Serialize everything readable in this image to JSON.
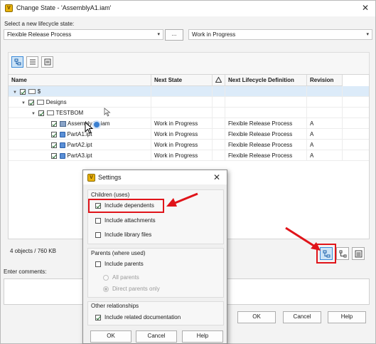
{
  "window": {
    "title": "Change State - 'AssemblyA1.iam'",
    "close_glyph": "✕"
  },
  "lifecycle": {
    "label": "Select a new lifecycle state:",
    "definition_value": "Flexible Release Process",
    "browse_label": "...",
    "state_value": "Work in Progress"
  },
  "grid": {
    "columns": [
      "Name",
      "Next State",
      "",
      "Next Lifecycle Definition",
      "Revision"
    ],
    "rows": [
      {
        "name": "$",
        "next_state": "",
        "definition": "",
        "revision": ""
      },
      {
        "name": "Designs",
        "next_state": "",
        "definition": "",
        "revision": ""
      },
      {
        "name": "TESTBOM",
        "next_state": "",
        "definition": "",
        "revision": ""
      },
      {
        "name": "AssemblyA1.iam",
        "next_state": "Work in Progress",
        "definition": "Flexible Release Process",
        "revision": "A"
      },
      {
        "name": "PartA1.ipt",
        "next_state": "Work in Progress",
        "definition": "Flexible Release Process",
        "revision": "A"
      },
      {
        "name": "PartA2.ipt",
        "next_state": "Work in Progress",
        "definition": "Flexible Release Process",
        "revision": "A"
      },
      {
        "name": "PartA3.ipt",
        "next_state": "Work in Progress",
        "definition": "Flexible Release Process",
        "revision": "A"
      }
    ]
  },
  "footer": {
    "count_text": "4 objects / 760 KB",
    "comments_label": "Enter comments:",
    "ok_label": "OK",
    "cancel_label": "Cancel",
    "help_label": "Help"
  },
  "settings": {
    "title": "Settings",
    "close_glyph": "✕",
    "children_group": "Children (uses)",
    "include_dependents": "Include dependents",
    "include_attachments": "Include attachments",
    "include_library": "Include library files",
    "parents_group": "Parents (where used)",
    "include_parents": "Include parents",
    "all_parents": "All parents",
    "direct_parents": "Direct parents only",
    "other_group": "Other relationships",
    "include_related_docs": "Include related documentation",
    "ok_label": "OK",
    "cancel_label": "Cancel",
    "help_label": "Help"
  },
  "accent": {
    "annotation_red": "#e0141a",
    "selection_blue": "#3c8ad8"
  }
}
